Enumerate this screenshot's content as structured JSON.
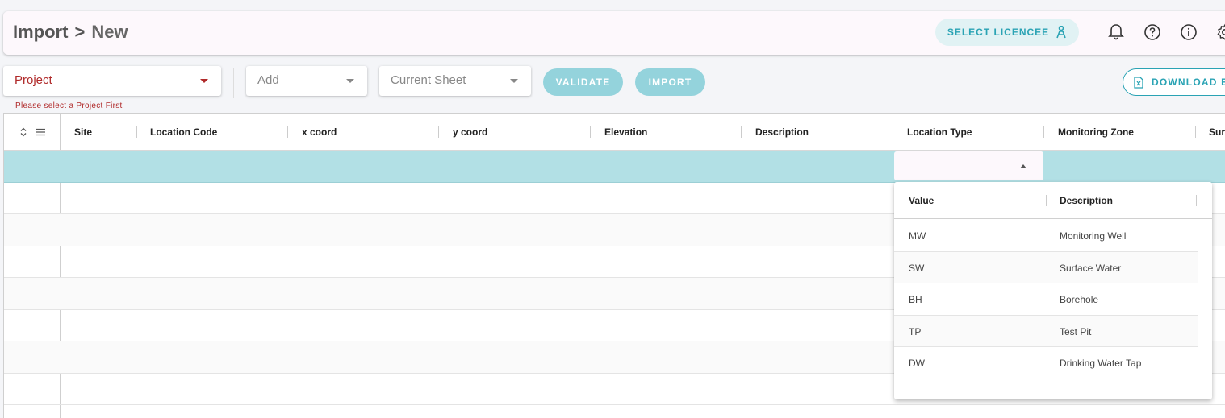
{
  "breadcrumb": {
    "parent": "Import",
    "separator": ">",
    "current": "New"
  },
  "header": {
    "licencee_label": "SELECT LICENCEE"
  },
  "toolbar": {
    "project": {
      "value": "Project",
      "error": "Please select a Project First"
    },
    "add": {
      "placeholder": "Add"
    },
    "sheet": {
      "placeholder": "Current Sheet"
    },
    "validate_label": "VALIDATE",
    "import_label": "IMPORT",
    "download_label": "DOWNLOAD E"
  },
  "grid": {
    "columns": [
      "Site",
      "Location Code",
      "x coord",
      "y coord",
      "Elevation",
      "Description",
      "Location Type",
      "Monitoring Zone",
      "Sur"
    ]
  },
  "dropdown": {
    "headers": [
      "Value",
      "Description"
    ],
    "options": [
      {
        "value": "MW",
        "description": "Monitoring Well"
      },
      {
        "value": "SW",
        "description": "Surface Water"
      },
      {
        "value": "BH",
        "description": "Borehole"
      },
      {
        "value": "TP",
        "description": "Test Pit"
      },
      {
        "value": "DW",
        "description": "Drinking Water Tap"
      }
    ]
  },
  "colors": {
    "accent": "#2aa3b4",
    "selected_row": "#b2e0e5",
    "button_disabled": "#94d3dc",
    "error": "#b02a2a"
  }
}
